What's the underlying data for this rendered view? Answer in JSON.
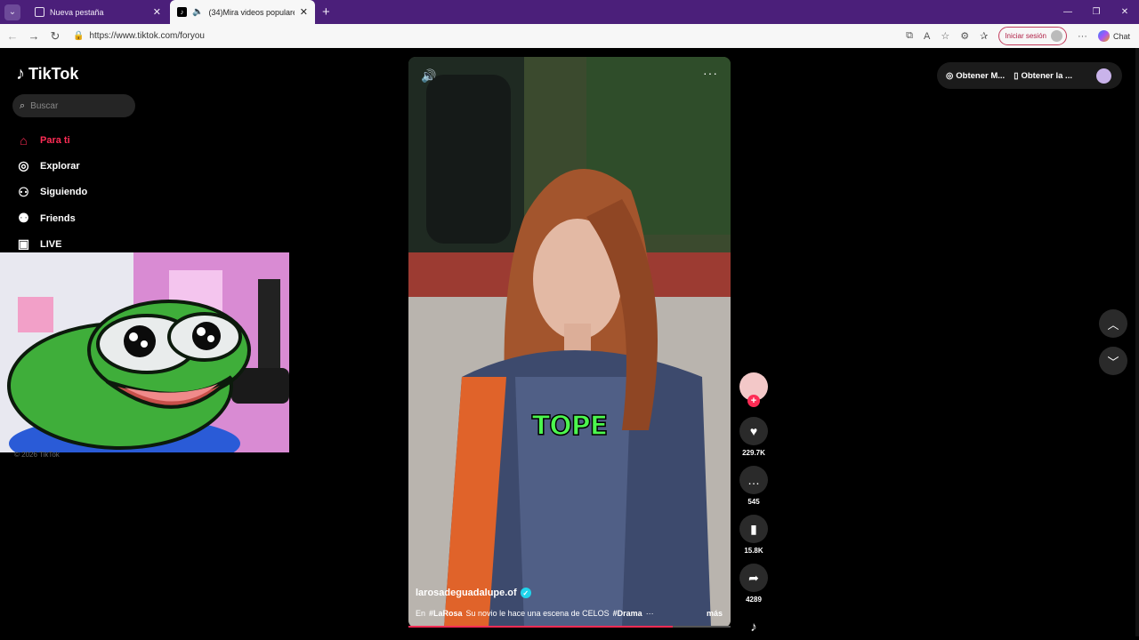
{
  "browser": {
    "tabs": [
      {
        "title": "Nueva pestaña",
        "active": false
      },
      {
        "title": "(34)Mira videos populares sel",
        "active": true
      }
    ],
    "url": "https://www.tiktok.com/foryou",
    "signin_label": "Iniciar sesión",
    "chat_label": "Chat"
  },
  "sidebar": {
    "logo_text": "TikTok",
    "search_placeholder": "Buscar",
    "items": [
      {
        "label": "Para ti",
        "icon": "home-icon",
        "active": true
      },
      {
        "label": "Explorar",
        "icon": "compass-icon",
        "active": false
      },
      {
        "label": "Siguiendo",
        "icon": "following-icon",
        "active": false
      },
      {
        "label": "Friends",
        "icon": "friends-icon",
        "active": false
      },
      {
        "label": "LIVE",
        "icon": "live-icon",
        "active": false
      }
    ],
    "copyright": "© 2026 TikTok"
  },
  "video": {
    "caption_overlay": "TOPE",
    "author": "larosadeguadalupe.of",
    "description": {
      "prefix": "En",
      "hashtag1": "#LaRosa",
      "text": "Su novio le hace una escena de CELOS",
      "hashtag2": "#Drama",
      "ellipsis": "···",
      "more": "más"
    },
    "progress": 0.82
  },
  "actions": {
    "likes": "229.7K",
    "comments": "545",
    "saves": "15.8K",
    "shares": "4289"
  },
  "top_right": {
    "coins_label": "Obtener M...",
    "app_label": "Obtener la ..."
  },
  "colors": {
    "accent": "#fe2c55",
    "caption": "#4cf64e",
    "browser_chrome": "#4b1f7a"
  }
}
